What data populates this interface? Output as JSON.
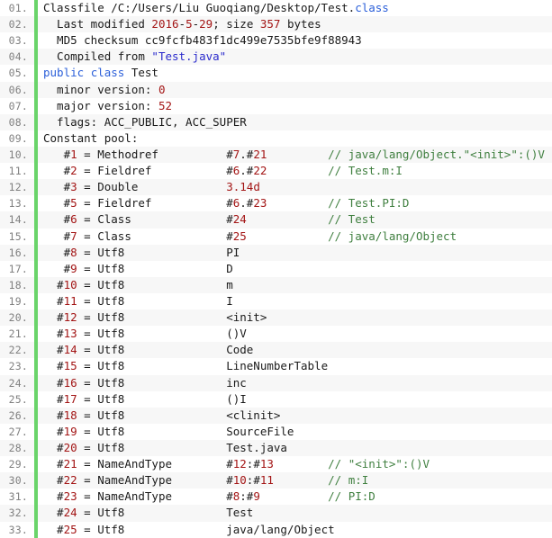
{
  "view": {
    "kind": "code-listing",
    "language": "javap-verbose-output",
    "colors": {
      "gutter_bg": "#e8e7e0",
      "gutter_bar": "#6ad46a",
      "row_odd": "#ffffff",
      "row_even": "#f7f7f7",
      "line_number": "#808080",
      "text": "#1a1a1a",
      "keyword": "#2b5fd9",
      "number": "#a31515",
      "comment": "#3f7f3f",
      "string": "#2a2acc"
    }
  },
  "lines": [
    {
      "number": "01.",
      "tokens": [
        {
          "t": "Classfile /C:/Users/Liu Guoqiang/Desktop/Test.",
          "c": "plain"
        },
        {
          "t": "class",
          "c": "kw"
        }
      ]
    },
    {
      "number": "02.",
      "tokens": [
        {
          "t": "  Last modified ",
          "c": "plain"
        },
        {
          "t": "2016",
          "c": "num"
        },
        {
          "t": "-",
          "c": "plain"
        },
        {
          "t": "5",
          "c": "num"
        },
        {
          "t": "-",
          "c": "plain"
        },
        {
          "t": "29",
          "c": "num"
        },
        {
          "t": "; size ",
          "c": "plain"
        },
        {
          "t": "357",
          "c": "num"
        },
        {
          "t": " bytes",
          "c": "plain"
        }
      ]
    },
    {
      "number": "03.",
      "tokens": [
        {
          "t": "  MD5 checksum cc9fcfb483f1dc499e7535bfe9f88943",
          "c": "plain"
        }
      ]
    },
    {
      "number": "04.",
      "tokens": [
        {
          "t": "  Compiled from ",
          "c": "plain"
        },
        {
          "t": "\"Test.java\"",
          "c": "str"
        }
      ]
    },
    {
      "number": "05.",
      "tokens": [
        {
          "t": "public",
          "c": "kw"
        },
        {
          "t": " ",
          "c": "plain"
        },
        {
          "t": "class",
          "c": "kw"
        },
        {
          "t": " Test",
          "c": "plain"
        }
      ]
    },
    {
      "number": "06.",
      "tokens": [
        {
          "t": "  minor version: ",
          "c": "plain"
        },
        {
          "t": "0",
          "c": "num"
        }
      ]
    },
    {
      "number": "07.",
      "tokens": [
        {
          "t": "  major version: ",
          "c": "plain"
        },
        {
          "t": "52",
          "c": "num"
        }
      ]
    },
    {
      "number": "08.",
      "tokens": [
        {
          "t": "  flags: ACC_PUBLIC, ACC_SUPER",
          "c": "plain"
        }
      ]
    },
    {
      "number": "09.",
      "tokens": [
        {
          "t": "Constant pool:",
          "c": "plain"
        }
      ]
    },
    {
      "number": "10.",
      "tokens": [
        {
          "t": "   #",
          "c": "plain"
        },
        {
          "t": "1",
          "c": "num"
        },
        {
          "t": " = Methodref          #",
          "c": "plain"
        },
        {
          "t": "7",
          "c": "num"
        },
        {
          "t": ".#",
          "c": "plain"
        },
        {
          "t": "21",
          "c": "num"
        },
        {
          "t": "         ",
          "c": "plain"
        },
        {
          "t": "// java/lang/Object.\"<init>\":()V",
          "c": "cmt"
        }
      ]
    },
    {
      "number": "11.",
      "tokens": [
        {
          "t": "   #",
          "c": "plain"
        },
        {
          "t": "2",
          "c": "num"
        },
        {
          "t": " = Fieldref           #",
          "c": "plain"
        },
        {
          "t": "6",
          "c": "num"
        },
        {
          "t": ".#",
          "c": "plain"
        },
        {
          "t": "22",
          "c": "num"
        },
        {
          "t": "         ",
          "c": "plain"
        },
        {
          "t": "// Test.m:I",
          "c": "cmt"
        }
      ]
    },
    {
      "number": "12.",
      "tokens": [
        {
          "t": "   #",
          "c": "plain"
        },
        {
          "t": "3",
          "c": "num"
        },
        {
          "t": " = Double             ",
          "c": "plain"
        },
        {
          "t": "3.14d",
          "c": "num"
        }
      ]
    },
    {
      "number": "13.",
      "tokens": [
        {
          "t": "   #",
          "c": "plain"
        },
        {
          "t": "5",
          "c": "num"
        },
        {
          "t": " = Fieldref           #",
          "c": "plain"
        },
        {
          "t": "6",
          "c": "num"
        },
        {
          "t": ".#",
          "c": "plain"
        },
        {
          "t": "23",
          "c": "num"
        },
        {
          "t": "         ",
          "c": "plain"
        },
        {
          "t": "// Test.PI:D",
          "c": "cmt"
        }
      ]
    },
    {
      "number": "14.",
      "tokens": [
        {
          "t": "   #",
          "c": "plain"
        },
        {
          "t": "6",
          "c": "num"
        },
        {
          "t": " = Class              #",
          "c": "plain"
        },
        {
          "t": "24",
          "c": "num"
        },
        {
          "t": "            ",
          "c": "plain"
        },
        {
          "t": "// Test",
          "c": "cmt"
        }
      ]
    },
    {
      "number": "15.",
      "tokens": [
        {
          "t": "   #",
          "c": "plain"
        },
        {
          "t": "7",
          "c": "num"
        },
        {
          "t": " = Class              #",
          "c": "plain"
        },
        {
          "t": "25",
          "c": "num"
        },
        {
          "t": "            ",
          "c": "plain"
        },
        {
          "t": "// java/lang/Object",
          "c": "cmt"
        }
      ]
    },
    {
      "number": "16.",
      "tokens": [
        {
          "t": "   #",
          "c": "plain"
        },
        {
          "t": "8",
          "c": "num"
        },
        {
          "t": " = Utf8               PI",
          "c": "plain"
        }
      ]
    },
    {
      "number": "17.",
      "tokens": [
        {
          "t": "   #",
          "c": "plain"
        },
        {
          "t": "9",
          "c": "num"
        },
        {
          "t": " = Utf8               D",
          "c": "plain"
        }
      ]
    },
    {
      "number": "18.",
      "tokens": [
        {
          "t": "  #",
          "c": "plain"
        },
        {
          "t": "10",
          "c": "num"
        },
        {
          "t": " = Utf8               m",
          "c": "plain"
        }
      ]
    },
    {
      "number": "19.",
      "tokens": [
        {
          "t": "  #",
          "c": "plain"
        },
        {
          "t": "11",
          "c": "num"
        },
        {
          "t": " = Utf8               I",
          "c": "plain"
        }
      ]
    },
    {
      "number": "20.",
      "tokens": [
        {
          "t": "  #",
          "c": "plain"
        },
        {
          "t": "12",
          "c": "num"
        },
        {
          "t": " = Utf8               <init>",
          "c": "plain"
        }
      ]
    },
    {
      "number": "21.",
      "tokens": [
        {
          "t": "  #",
          "c": "plain"
        },
        {
          "t": "13",
          "c": "num"
        },
        {
          "t": " = Utf8               ()V",
          "c": "plain"
        }
      ]
    },
    {
      "number": "22.",
      "tokens": [
        {
          "t": "  #",
          "c": "plain"
        },
        {
          "t": "14",
          "c": "num"
        },
        {
          "t": " = Utf8               Code",
          "c": "plain"
        }
      ]
    },
    {
      "number": "23.",
      "tokens": [
        {
          "t": "  #",
          "c": "plain"
        },
        {
          "t": "15",
          "c": "num"
        },
        {
          "t": " = Utf8               LineNumberTable",
          "c": "plain"
        }
      ]
    },
    {
      "number": "24.",
      "tokens": [
        {
          "t": "  #",
          "c": "plain"
        },
        {
          "t": "16",
          "c": "num"
        },
        {
          "t": " = Utf8               inc",
          "c": "plain"
        }
      ]
    },
    {
      "number": "25.",
      "tokens": [
        {
          "t": "  #",
          "c": "plain"
        },
        {
          "t": "17",
          "c": "num"
        },
        {
          "t": " = Utf8               ()I",
          "c": "plain"
        }
      ]
    },
    {
      "number": "26.",
      "tokens": [
        {
          "t": "  #",
          "c": "plain"
        },
        {
          "t": "18",
          "c": "num"
        },
        {
          "t": " = Utf8               <clinit>",
          "c": "plain"
        }
      ]
    },
    {
      "number": "27.",
      "tokens": [
        {
          "t": "  #",
          "c": "plain"
        },
        {
          "t": "19",
          "c": "num"
        },
        {
          "t": " = Utf8               SourceFile",
          "c": "plain"
        }
      ]
    },
    {
      "number": "28.",
      "tokens": [
        {
          "t": "  #",
          "c": "plain"
        },
        {
          "t": "20",
          "c": "num"
        },
        {
          "t": " = Utf8               Test.java",
          "c": "plain"
        }
      ]
    },
    {
      "number": "29.",
      "tokens": [
        {
          "t": "  #",
          "c": "plain"
        },
        {
          "t": "21",
          "c": "num"
        },
        {
          "t": " = NameAndType        #",
          "c": "plain"
        },
        {
          "t": "12",
          "c": "num"
        },
        {
          "t": ":#",
          "c": "plain"
        },
        {
          "t": "13",
          "c": "num"
        },
        {
          "t": "        ",
          "c": "plain"
        },
        {
          "t": "// \"<init>\":()V",
          "c": "cmt"
        }
      ]
    },
    {
      "number": "30.",
      "tokens": [
        {
          "t": "  #",
          "c": "plain"
        },
        {
          "t": "22",
          "c": "num"
        },
        {
          "t": " = NameAndType        #",
          "c": "plain"
        },
        {
          "t": "10",
          "c": "num"
        },
        {
          "t": ":#",
          "c": "plain"
        },
        {
          "t": "11",
          "c": "num"
        },
        {
          "t": "        ",
          "c": "plain"
        },
        {
          "t": "// m:I",
          "c": "cmt"
        }
      ]
    },
    {
      "number": "31.",
      "tokens": [
        {
          "t": "  #",
          "c": "plain"
        },
        {
          "t": "23",
          "c": "num"
        },
        {
          "t": " = NameAndType        #",
          "c": "plain"
        },
        {
          "t": "8",
          "c": "num"
        },
        {
          "t": ":#",
          "c": "plain"
        },
        {
          "t": "9",
          "c": "num"
        },
        {
          "t": "          ",
          "c": "plain"
        },
        {
          "t": "// PI:D",
          "c": "cmt"
        }
      ]
    },
    {
      "number": "32.",
      "tokens": [
        {
          "t": "  #",
          "c": "plain"
        },
        {
          "t": "24",
          "c": "num"
        },
        {
          "t": " = Utf8               Test",
          "c": "plain"
        }
      ]
    },
    {
      "number": "33.",
      "tokens": [
        {
          "t": "  #",
          "c": "plain"
        },
        {
          "t": "25",
          "c": "num"
        },
        {
          "t": " = Utf8               java/lang/Object",
          "c": "plain"
        }
      ]
    }
  ]
}
